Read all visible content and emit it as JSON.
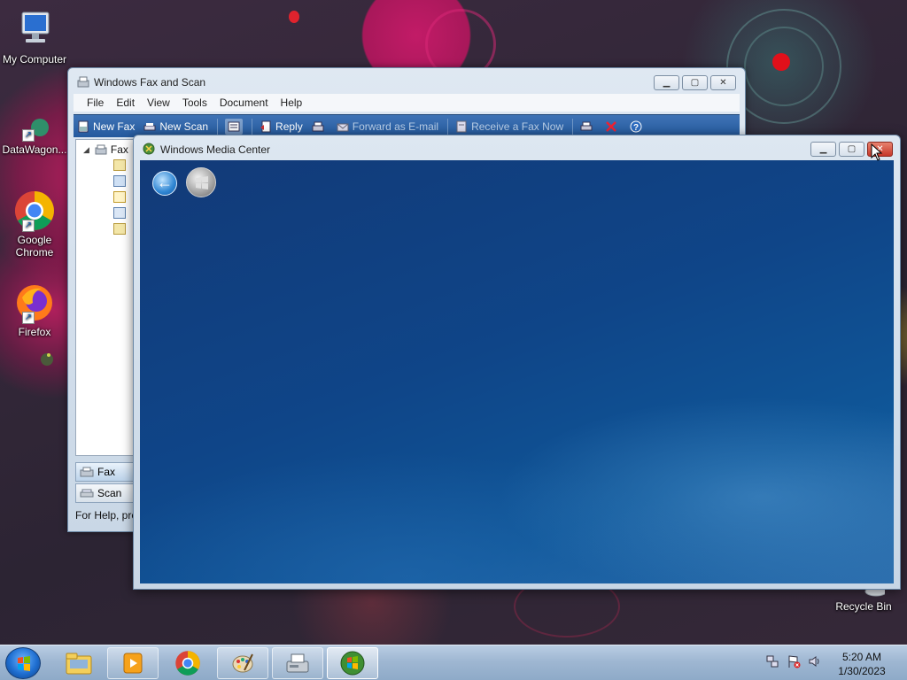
{
  "desktop": {
    "icons": [
      {
        "label": "My Computer"
      },
      {
        "label": "DataWagon..."
      },
      {
        "label": "Google Chrome"
      },
      {
        "label": "Firefox"
      },
      {
        "label": "Recycle Bin"
      }
    ]
  },
  "fax_window": {
    "title": "Windows Fax and Scan",
    "menu": [
      "File",
      "Edit",
      "View",
      "Tools",
      "Document",
      "Help"
    ],
    "toolbar": {
      "new_fax": "New Fax",
      "new_scan": "New Scan",
      "reply": "Reply",
      "forward": "Forward as E-mail",
      "receive": "Receive a Fax Now"
    },
    "tree_root": "Fax",
    "nav": {
      "fax": "Fax",
      "scan": "Scan"
    },
    "status": "For Help, pre"
  },
  "wmc_window": {
    "title": "Windows Media Center"
  },
  "taskbar": {
    "clock_time": "5:20 AM",
    "clock_date": "1/30/2023"
  },
  "colors": {
    "wmc_blue": "#0f4588",
    "toolbar_blue": "#2f64a8",
    "close_red": "#c7382a"
  }
}
